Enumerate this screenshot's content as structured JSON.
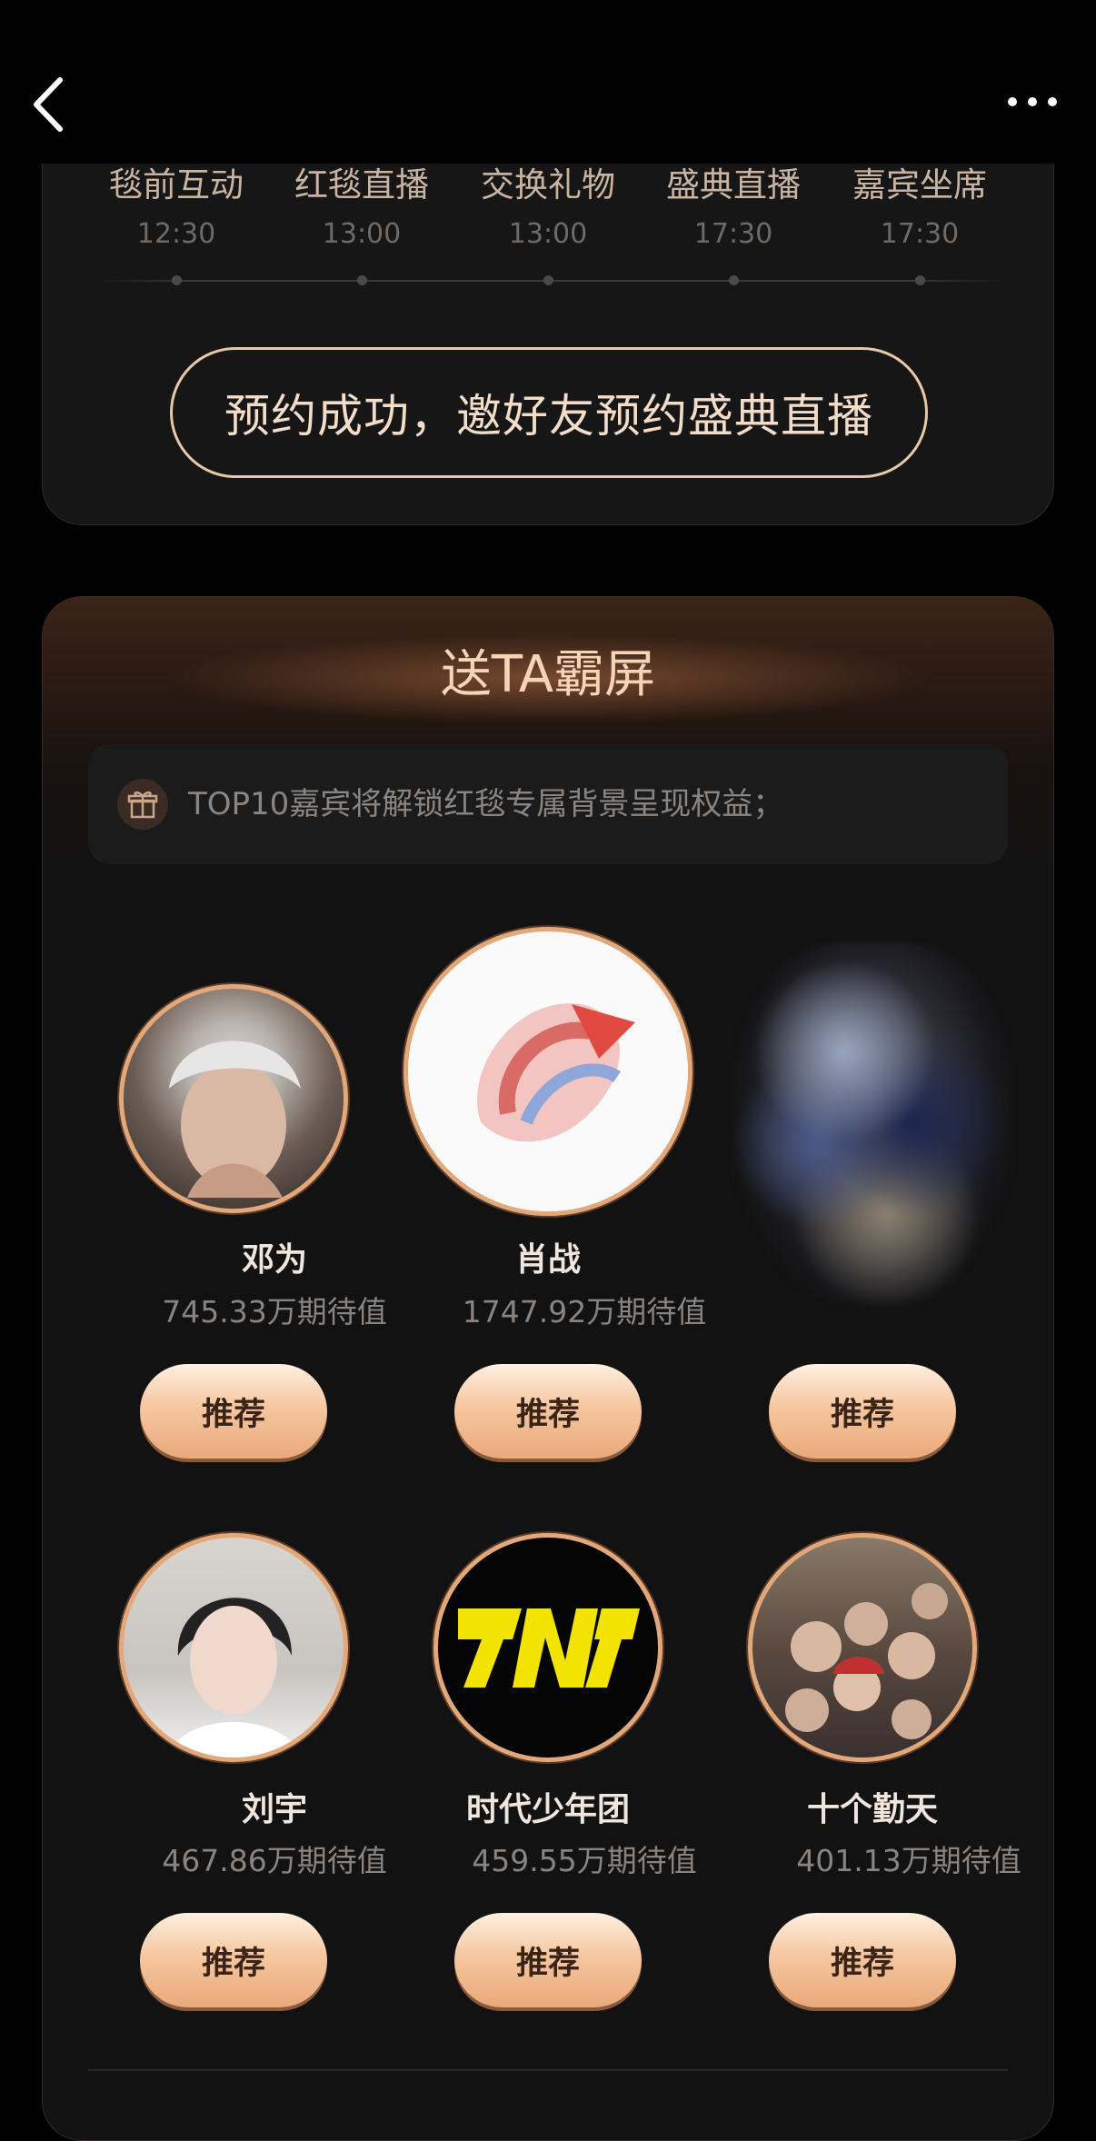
{
  "nav": {
    "back_icon": "chevron-left-icon",
    "more_icon": "more-horizontal-icon"
  },
  "schedule": {
    "steps": [
      {
        "name": "毯前互动",
        "time": "12:30"
      },
      {
        "name": "红毯直播",
        "time": "13:00"
      },
      {
        "name": "交换礼物",
        "time": "13:00"
      },
      {
        "name": "盛典直播",
        "time": "17:30"
      },
      {
        "name": "嘉宾坐席",
        "time": "17:30"
      }
    ],
    "reserve_label": "预约成功，邀好友预约盛典直播"
  },
  "ranking": {
    "title": "送TA霸屏",
    "notice": "TOP10嘉宾将解锁红毯专属背景呈现权益；",
    "gift_icon": "gift-icon",
    "items": [
      {
        "name": "邓为",
        "score": "745.33万期待值",
        "button": "推荐"
      },
      {
        "name": "肖战",
        "score": "1747.92万期待值",
        "button": "推荐"
      },
      {
        "name": "",
        "score": "",
        "button": "推荐"
      },
      {
        "name": "刘宇",
        "score": "467.86万期待值",
        "button": "推荐"
      },
      {
        "name": "时代少年团",
        "score": "459.55万期待值",
        "button": "推荐"
      },
      {
        "name": "十个勤天",
        "score": "401.13万期待值",
        "button": "推荐"
      }
    ],
    "tnt_logo": "TNT"
  },
  "colors": {
    "accent": "#e2a87a",
    "button_top": "#fff0e0",
    "button_bottom": "#e9a97a"
  }
}
